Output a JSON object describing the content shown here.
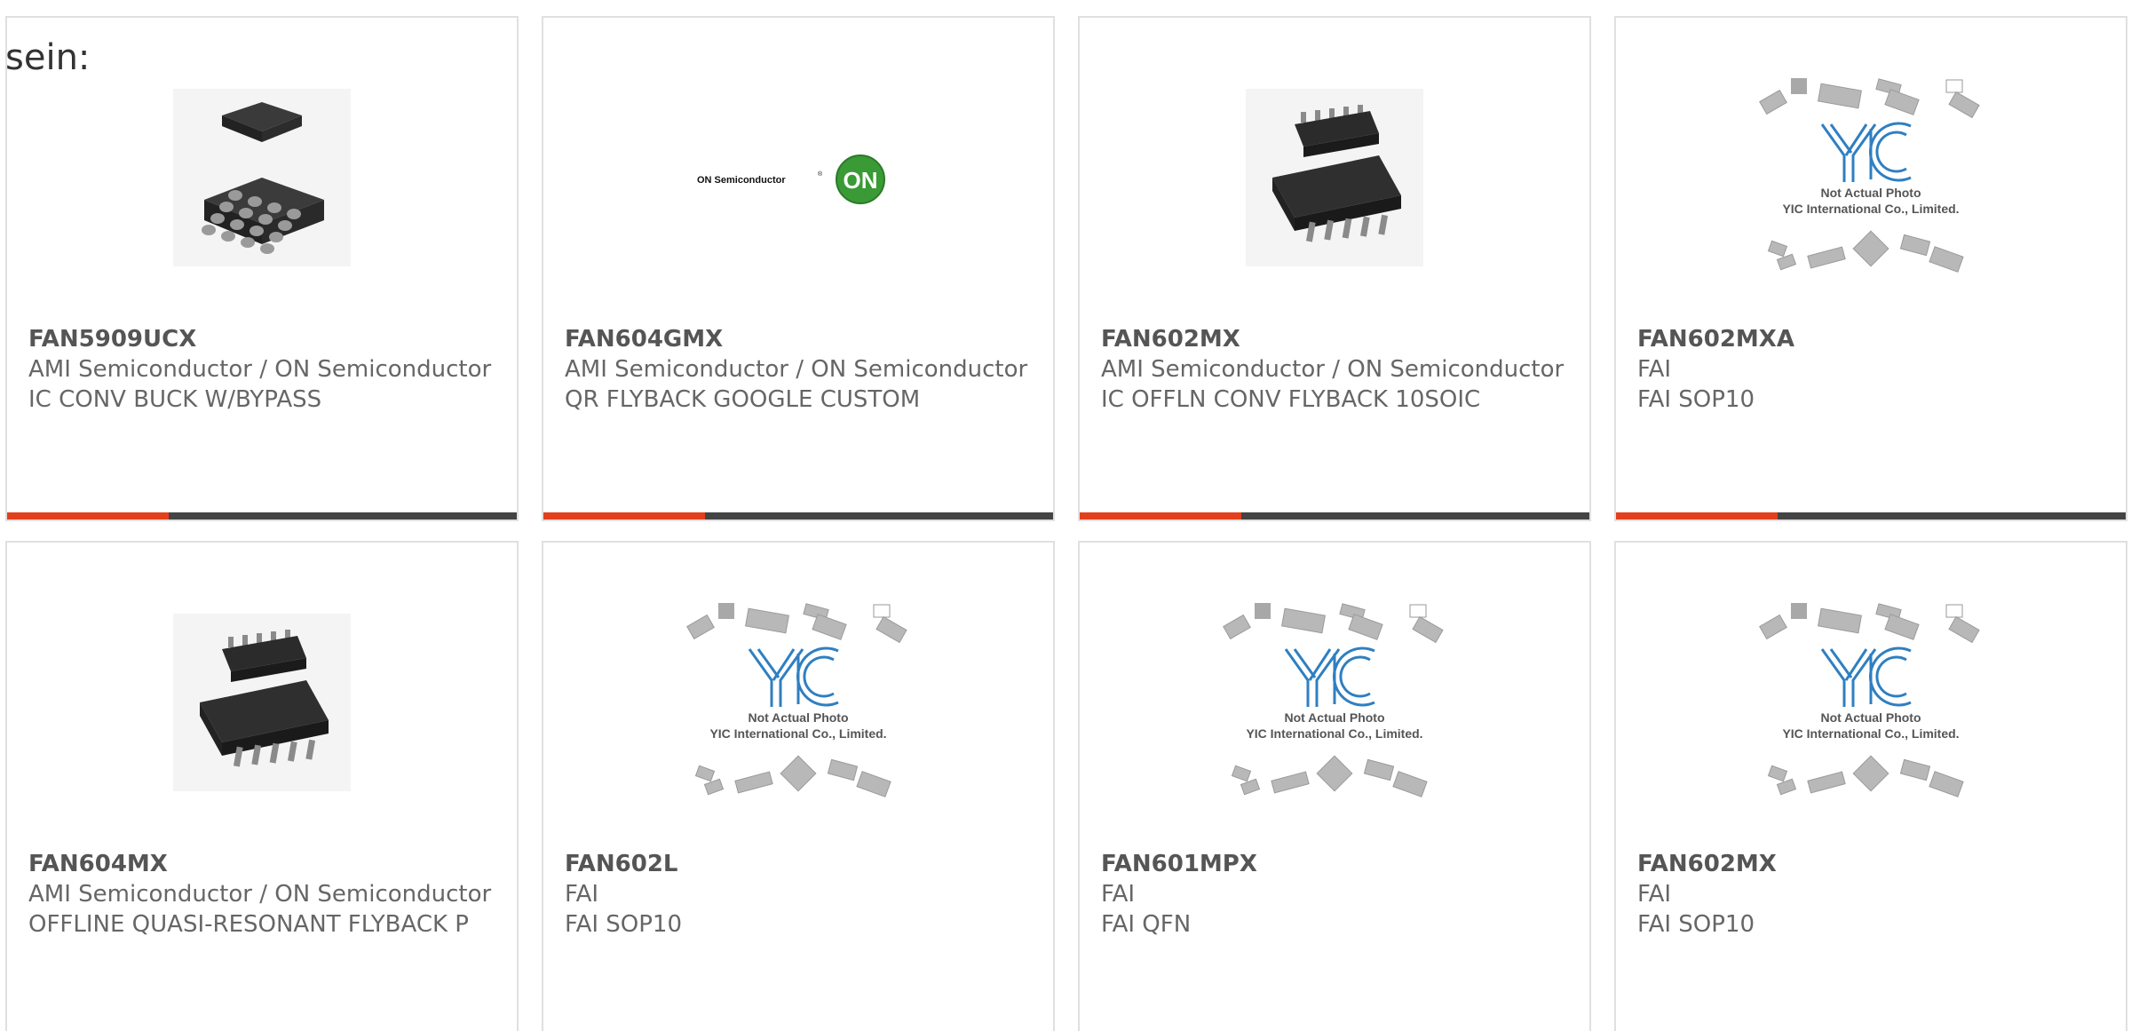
{
  "page": {
    "prefix_text": "sein:"
  },
  "colors": {
    "accent": "#e2401c",
    "bar_dark": "#444444",
    "border": "#e0e0e0",
    "on_logo_green": "#3a9a35",
    "yic_blue": "#2f7fc1"
  },
  "placeholder": {
    "line1": "Not Actual Photo",
    "line2": "YIC International Co., Limited."
  },
  "on_logo": {
    "wordmark": "ON Semiconductor",
    "badge": "ON"
  },
  "products": [
    {
      "part_number": "FAN5909UCX",
      "manufacturer": "AMI Semiconductor / ON Semiconductor",
      "description": "IC CONV BUCK W/BYPASS",
      "image": "bga-chip-icon",
      "show_bar": true
    },
    {
      "part_number": "FAN604GMX",
      "manufacturer": "AMI Semiconductor / ON Semiconductor",
      "description": "QR FLYBACK GOOGLE CUSTOM",
      "image": "on-semiconductor-logo",
      "show_bar": true
    },
    {
      "part_number": "FAN602MX",
      "manufacturer": "AMI Semiconductor / ON Semiconductor",
      "description": "IC OFFLN CONV FLYBACK 10SOIC",
      "image": "soic-chip-icon",
      "show_bar": true
    },
    {
      "part_number": "FAN602MXA",
      "manufacturer": "FAI",
      "description": "FAI SOP10",
      "image": "yic-placeholder-icon",
      "show_bar": true
    },
    {
      "part_number": "FAN604MX",
      "manufacturer": "AMI Semiconductor / ON Semiconductor",
      "description": "OFFLINE QUASI-RESONANT FLYBACK P",
      "image": "soic-chip-icon",
      "show_bar": false
    },
    {
      "part_number": "FAN602L",
      "manufacturer": "FAI",
      "description": "FAI SOP10",
      "image": "yic-placeholder-icon",
      "show_bar": false
    },
    {
      "part_number": "FAN601MPX",
      "manufacturer": "FAI",
      "description": "FAI QFN",
      "image": "yic-placeholder-icon",
      "show_bar": false
    },
    {
      "part_number": "FAN602MX",
      "manufacturer": "FAI",
      "description": "FAI SOP10",
      "image": "yic-placeholder-icon",
      "show_bar": false
    }
  ]
}
